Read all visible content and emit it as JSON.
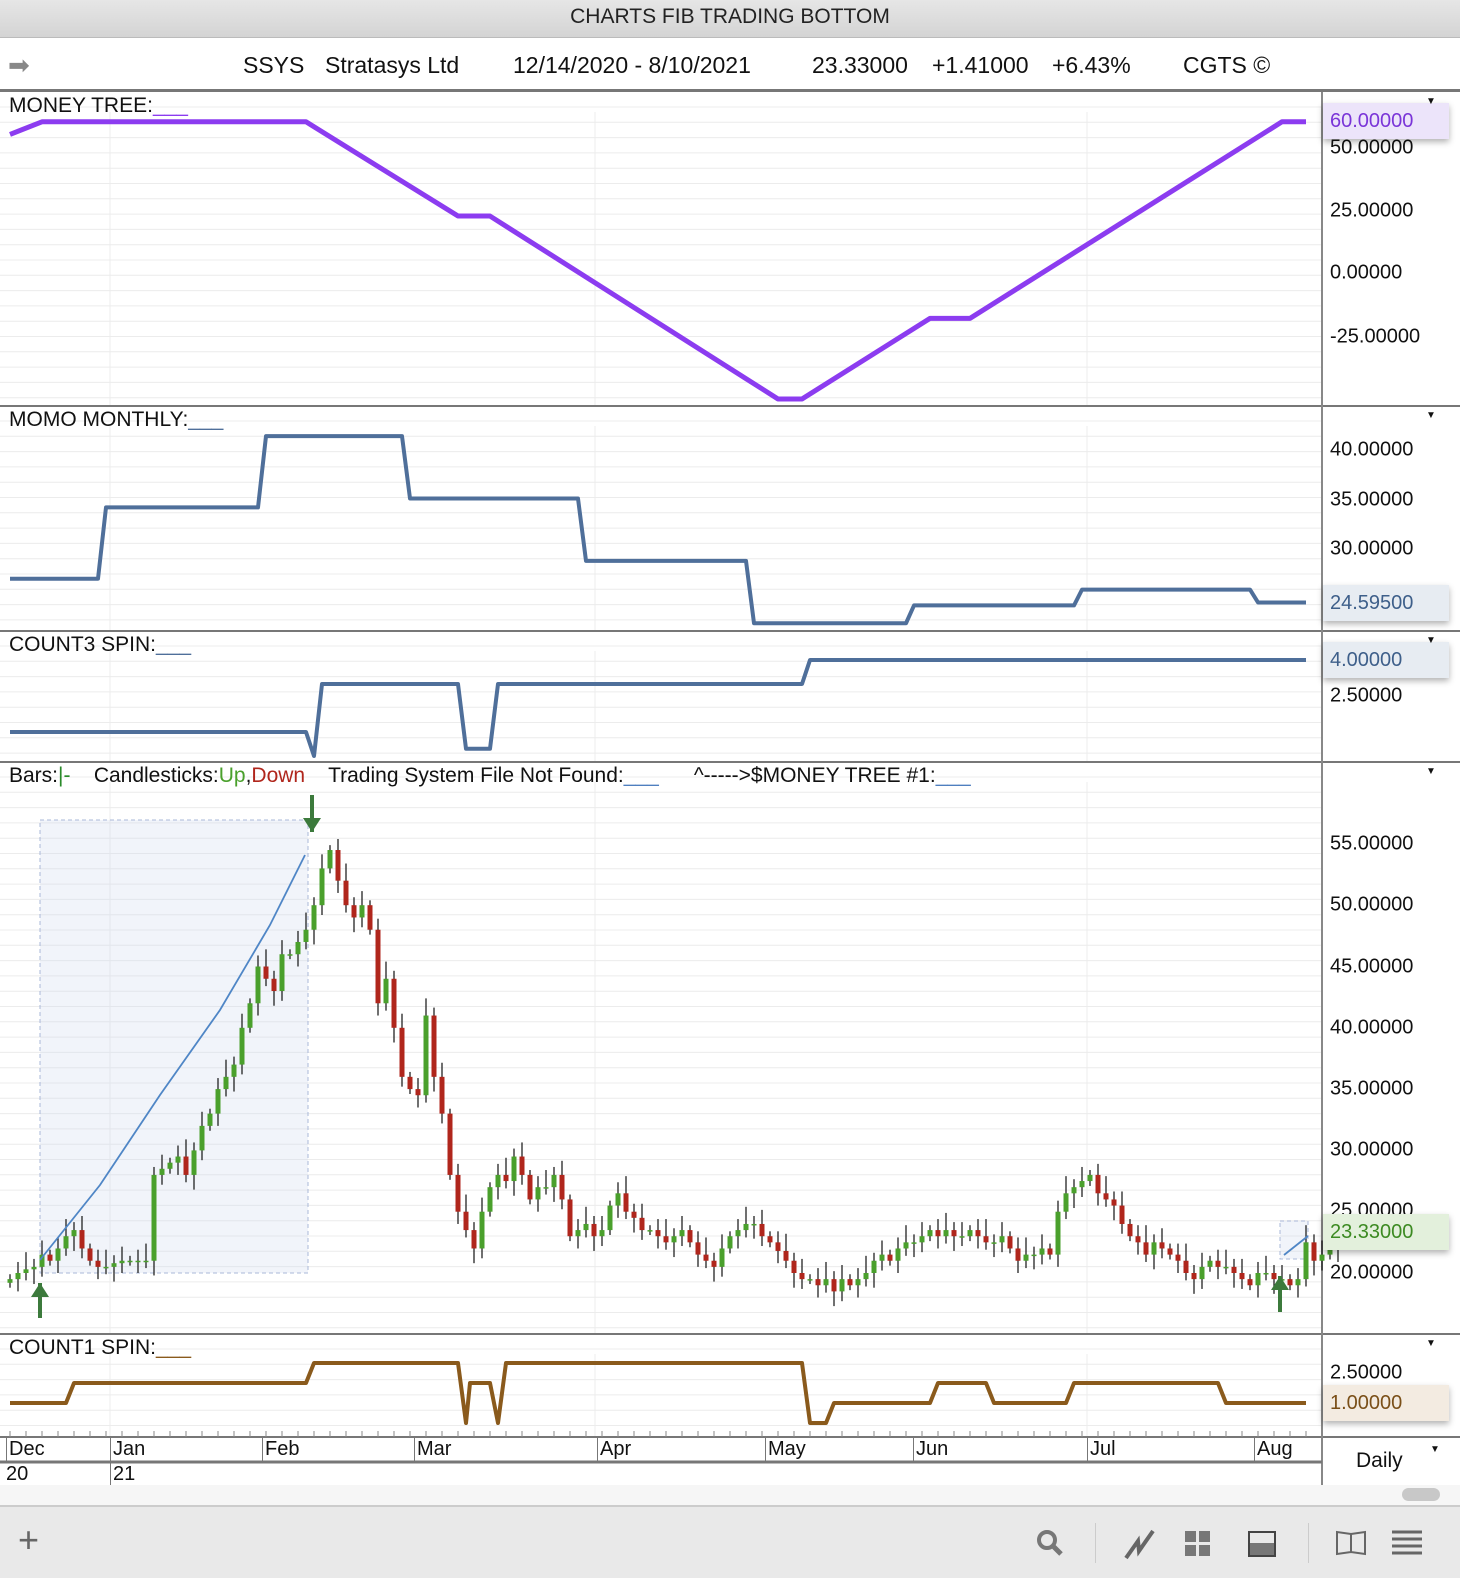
{
  "window_title": "CHARTS FIB TRADING BOTTOM",
  "info": {
    "symbol": "SSYS",
    "name": "Stratasys Ltd",
    "range": "12/14/2020 - 8/10/2021",
    "last": "23.33000",
    "change": "+1.41000",
    "pct": "+6.43%",
    "credit": "CGTS ©"
  },
  "panels": {
    "money_tree": {
      "label": "MONEY TREE:",
      "line": "___",
      "color": "#8c3cf0",
      "axis": [
        "50.00000",
        "25.00000",
        "0.00000",
        "-25.00000"
      ],
      "current": "60.00000",
      "points": [
        [
          0,
          55
        ],
        [
          4,
          60
        ],
        [
          37,
          60
        ],
        [
          56,
          22.6
        ],
        [
          60,
          22.6
        ],
        [
          96,
          -50
        ],
        [
          99,
          -50
        ],
        [
          115,
          -18
        ],
        [
          120,
          -18
        ],
        [
          159,
          60
        ],
        [
          162,
          60
        ]
      ]
    },
    "momo": {
      "label": "MOMO MONTHLY:",
      "line": "___",
      "color": "#4f6f9a",
      "axis": [
        "40.00000",
        "35.00000",
        "30.00000"
      ],
      "current": "24.59500",
      "points": [
        [
          0,
          27
        ],
        [
          11,
          27
        ],
        [
          12,
          34.2
        ],
        [
          31,
          34.2
        ],
        [
          32,
          41.4
        ],
        [
          49,
          41.4
        ],
        [
          50,
          35.1
        ],
        [
          71,
          35.1
        ],
        [
          72,
          28.8
        ],
        [
          92,
          28.8
        ],
        [
          93,
          22.5
        ],
        [
          112,
          22.5
        ],
        [
          113,
          24.3
        ],
        [
          133,
          24.3
        ],
        [
          134,
          25.9
        ],
        [
          155,
          25.9
        ],
        [
          156,
          24.6
        ],
        [
          162,
          24.6
        ]
      ]
    },
    "count3": {
      "label": "COUNT3 SPIN:",
      "line": "___",
      "color": "#4f6f9a",
      "axis": [
        "2.50000"
      ],
      "current": "4.00000",
      "points": [
        [
          0,
          1
        ],
        [
          37,
          1
        ],
        [
          38,
          0
        ],
        [
          39,
          3
        ],
        [
          56,
          3
        ],
        [
          57,
          0.3
        ],
        [
          60,
          0.3
        ],
        [
          61,
          3
        ],
        [
          99,
          3
        ],
        [
          100,
          4
        ],
        [
          162,
          4
        ]
      ]
    },
    "price": {
      "bars_label": "Bars:",
      "bars_val": "|-",
      "candles_label": "Candlesticks:",
      "up": "Up",
      "comma": ",",
      "down": "Down",
      "system": "Trading System File Not Found:",
      "line": "___",
      "mt_ref": "^----->$MONEY TREE #1:",
      "up_color": "#4aa02c",
      "down_color": "#b0261c",
      "axis": [
        "55.00000",
        "50.00000",
        "45.00000",
        "40.00000",
        "35.00000",
        "30.00000",
        "25.00000",
        "20.00000"
      ],
      "current": "23.33000",
      "closes": [
        19.5,
        20,
        20.3,
        20.5,
        21.5,
        21,
        22,
        23,
        23.5,
        22,
        21,
        20.5,
        20.5,
        20.8,
        21,
        21,
        21,
        21,
        28,
        28.5,
        29,
        29.5,
        28,
        30,
        32,
        33,
        35,
        36,
        37,
        40,
        42,
        45,
        44,
        43,
        46,
        46,
        47,
        48,
        50,
        53,
        54.5,
        52,
        50,
        49,
        50,
        48,
        42,
        44,
        40,
        36,
        35,
        34.5,
        41,
        36,
        33,
        28,
        25,
        23.5,
        22,
        25,
        27,
        28,
        27.5,
        29.5,
        28,
        26,
        27,
        27,
        28,
        26,
        23,
        23.5,
        24,
        23,
        23.5,
        25.5,
        26.5,
        25,
        24.5,
        23.5,
        23.5,
        23,
        22.5,
        23,
        23.5,
        22.5,
        21.5,
        21,
        20.5,
        22,
        23,
        23.5,
        24,
        24,
        23,
        22.5,
        21.8,
        21,
        20,
        19.5,
        19.5,
        19,
        19.5,
        18.5,
        19.5,
        19,
        19.5,
        20,
        21,
        21.5,
        21,
        22,
        22.5,
        22.5,
        23,
        23.5,
        23,
        23.5,
        23,
        23,
        23.5,
        23,
        22.5,
        22.5,
        23,
        22,
        21,
        21.5,
        21.5,
        22,
        21.5,
        25,
        26.5,
        27,
        27.5,
        28,
        26.5,
        26,
        25.5,
        24,
        23,
        22.5,
        21.5,
        22.5,
        22,
        21.5,
        21,
        20,
        19.5,
        20.5,
        21,
        20.5,
        20.5,
        20,
        19.5,
        19,
        20,
        20,
        19.5,
        19.5,
        19,
        19.5,
        22.5,
        21,
        21.5,
        21.9,
        23.33
      ]
    },
    "count1": {
      "label": "COUNT1 SPIN:",
      "line": "___",
      "color": "#8a5a1c",
      "axis": [
        "2.50000"
      ],
      "current": "1.00000",
      "points": [
        [
          0,
          1
        ],
        [
          7,
          1
        ],
        [
          8,
          2
        ],
        [
          37,
          2
        ],
        [
          38,
          3
        ],
        [
          56,
          3
        ],
        [
          57,
          0
        ],
        [
          57.5,
          2
        ],
        [
          60,
          2
        ],
        [
          61,
          0
        ],
        [
          62,
          3
        ],
        [
          99,
          3
        ],
        [
          100,
          0
        ],
        [
          102,
          0
        ],
        [
          103,
          1
        ],
        [
          115,
          1
        ],
        [
          116,
          2
        ],
        [
          122,
          2
        ],
        [
          123,
          1
        ],
        [
          132,
          1
        ],
        [
          133,
          2
        ],
        [
          151,
          2
        ],
        [
          152,
          1
        ],
        [
          162,
          1
        ]
      ]
    }
  },
  "months": [
    "Dec",
    "Jan",
    "Feb",
    "Mar",
    "Apr",
    "May",
    "Jun",
    "Jul",
    "Aug"
  ],
  "years": [
    "20",
    "21"
  ],
  "period": "Daily"
}
